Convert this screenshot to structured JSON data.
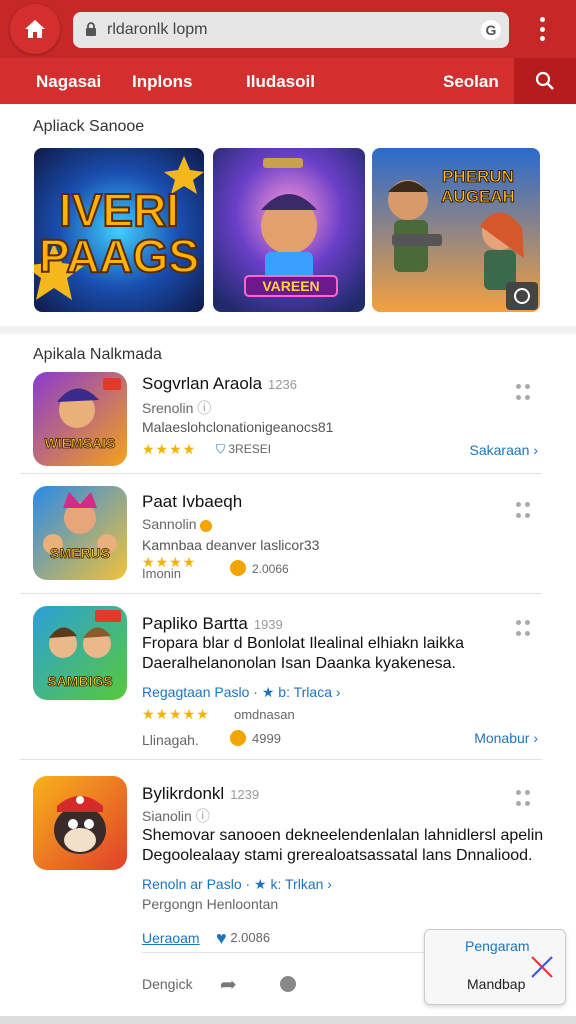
{
  "browser": {
    "url": "rldaronlk lopm",
    "icons": {
      "home": "home-icon",
      "lock": "lock-icon",
      "google": "google-icon",
      "menu": "more-vert-icon"
    }
  },
  "nav": {
    "items": [
      "Nagasai",
      "Inplons",
      "Iludasoil",
      "Seolan"
    ],
    "search_icon": "search-icon"
  },
  "featured": {
    "title": "Apliack Sanooe",
    "banners": [
      {
        "text_line1": "IVERI",
        "text_line2": "PAAGS"
      },
      {
        "text": "VAREEN"
      },
      {
        "text_line1": "PHERUN",
        "text_line2": "AUGEAH"
      }
    ]
  },
  "list": {
    "title": "Apikala Nalkmada",
    "apps": [
      {
        "name": "Sogvrlan Araola",
        "num": "1236",
        "dev": "Srenolin",
        "desc": "Malaeslohclonationigeanocs81",
        "rating": "★★★★",
        "extra": "3RESEI",
        "link": "Sakaraan ›",
        "icon_text": "WIEMSAIS"
      },
      {
        "name": "Paat Ivbaeqh",
        "num": "",
        "dev": "Sannolin",
        "desc": "Kamnbaa deanver laslicor33",
        "rating": "★★★★",
        "extra_label": "Imonin",
        "extra": "2.0066",
        "icon_text": "SMERUS"
      },
      {
        "name": "Papliko Bartta",
        "num": "1939",
        "desc_line1": "Fropara blar d Bonlolat Ilealinal elhiakn laikka",
        "desc_line2": "Daeralhelanonolan Isan Daanka kyakenesa.",
        "link1": "Regagtaan Paslo · ★ b: Trlaca ›",
        "rating": "★★★★★",
        "extra_text": "omdnasan",
        "label": "Llinagah.",
        "extra": "4999",
        "link": "Monabur ›",
        "icon_text": "SAMBIGS"
      },
      {
        "name": "Bylikrdonkl",
        "num": "1239",
        "dev": "Sianolin",
        "desc_line1": "Shemovar sanooen dekneelendenlalan lahnidlersl apelin",
        "desc_line2": "Degoolealaay stami grerealoatsassatal lans Dnnaliood.",
        "link1": "Renoln ar Paslo · ★ k: Trlkan ›",
        "sub": "Pergongn Henloontan",
        "link2": "Ueraoam",
        "extra": "2.0086",
        "bottom_label": "Dengick"
      }
    ]
  },
  "popup": {
    "line1": "Pengaram",
    "line2": "Mandbap",
    "close_icon": "close-x-icon"
  },
  "colors": {
    "brand_red": "#d32f2f",
    "link_blue": "#1e73be",
    "star": "#f5b301"
  }
}
